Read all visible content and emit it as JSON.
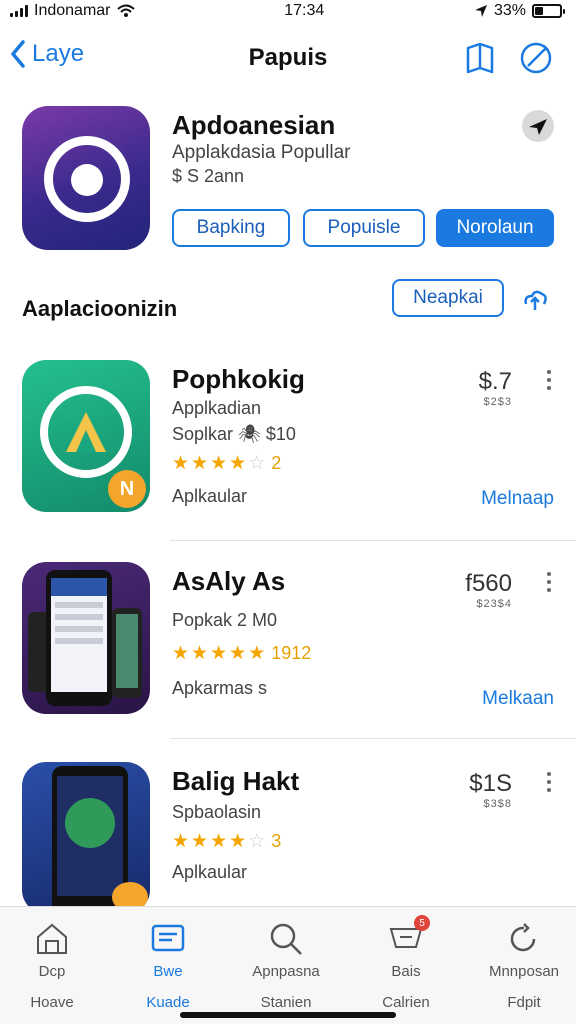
{
  "status": {
    "carrier": "Indonamar",
    "time": "17:34",
    "battery": "33%",
    "battery_level": 0.33
  },
  "nav": {
    "back_label": "Laye",
    "title": "Papuis"
  },
  "hero": {
    "title": "Apdoanesian",
    "subtitle": "Applakdasia Popullar",
    "meta": "$ S 2ann",
    "buttons": [
      "Bapking",
      "Popuisle",
      "Norolaun"
    ]
  },
  "section": {
    "title": "Aaplacioonizin",
    "action": "Neapkai"
  },
  "apps": [
    {
      "name": "Pophkokig",
      "line1": "Applkadian",
      "line2": "Soplkar 🕷 $10",
      "rating_count": "2",
      "stars_on": 4,
      "category": "Aplkaular",
      "price": "$.7",
      "price_sub": "$2$3",
      "action": "Melnaap",
      "thumb_color": "#1aa77f"
    },
    {
      "name": "AsAly As",
      "line1": "Popkak 2 M0",
      "rating_count": "1912",
      "stars_on": 5,
      "category": "Apkarmas s",
      "price": "f560",
      "price_sub": "$23$4",
      "action": "Melkaan",
      "thumb_color": "#3b1f62"
    },
    {
      "name": "Balig Hakt",
      "line1": "Spbaolasin",
      "rating_count": "3",
      "stars_on": 4,
      "category": "Aplkaular",
      "price": "$1S",
      "price_sub": "$3$8",
      "action": "",
      "thumb_color": "#1f3a8a"
    }
  ],
  "tabs": [
    {
      "top": "Dcp",
      "bottom": "Hoave",
      "icon": "home-icon",
      "active": false
    },
    {
      "top": "Bwe",
      "bottom": "Kuade",
      "icon": "apps-icon",
      "active": true
    },
    {
      "top": "Apnpasna",
      "bottom": "Stanien",
      "icon": "search-icon",
      "active": false
    },
    {
      "top": "Bais",
      "bottom": "Calrien",
      "icon": "cart-icon",
      "active": false,
      "badge": "5"
    },
    {
      "top": "Mnnposan",
      "bottom": "Fdpit",
      "icon": "refresh-icon",
      "active": false
    }
  ],
  "colors": {
    "accent": "#1a7ae0",
    "star": "#f5a500",
    "background": "#ffffff"
  }
}
